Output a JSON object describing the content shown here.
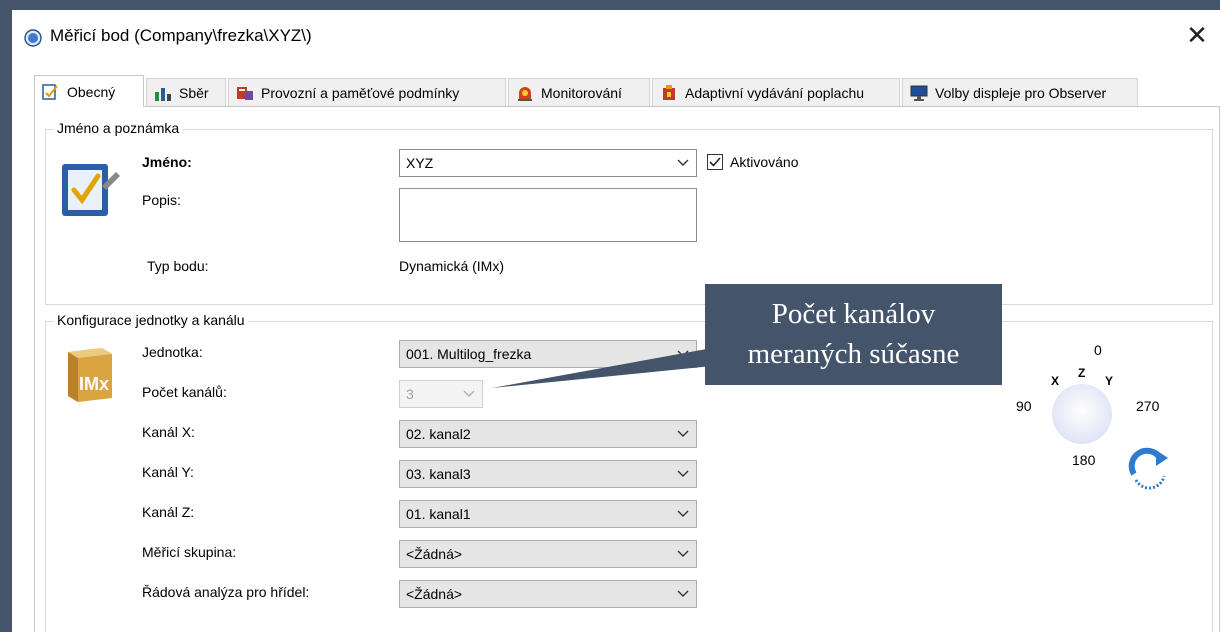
{
  "window": {
    "title": "Měřicí bod (Company\\frezka\\XYZ\\)",
    "close_glyph": "✕"
  },
  "tabs": [
    {
      "label": "Obecný",
      "icon": "general-icon",
      "active": true
    },
    {
      "label": "Sběr",
      "icon": "collection-icon"
    },
    {
      "label": "Provozní a paměťové podmínky",
      "icon": "conditions-icon"
    },
    {
      "label": "Monitorování",
      "icon": "monitoring-icon"
    },
    {
      "label": "Adaptivní vydávání poplachu",
      "icon": "alarm-icon"
    },
    {
      "label": "Volby displeje pro Observer",
      "icon": "monitor-icon"
    }
  ],
  "name_group": {
    "legend": "Jméno a poznámka",
    "name_label": "Jméno:",
    "name_value": "XYZ",
    "enabled_label": "Aktivováno",
    "enabled_checked": true,
    "description_label": "Popis:",
    "description_value": "",
    "point_type_label": "Typ bodu:",
    "point_type_value": "Dynamická (IMx)"
  },
  "config_group": {
    "legend": "Konfigurace jednotky a kanálu",
    "unit_label": "Jednotka:",
    "unit_value": "001. Multilog_frezka",
    "channels_label": "Počet kanálů:",
    "channels_value": "3",
    "channel_x_label": "Kanál X:",
    "channel_x_value": "02. kanal2",
    "channel_y_label": "Kanál Y:",
    "channel_y_value": "03. kanal3",
    "channel_z_label": "Kanál Z:",
    "channel_z_value": "01. kanal1",
    "group_label": "Měřicí skupina:",
    "group_value": "<Žádná>",
    "order_label": "Řádová analýza pro hřídel:",
    "order_value": "<Žádná>",
    "imx_icon_text": "IMx"
  },
  "orientation": {
    "top": "0",
    "left": "90",
    "right": "270",
    "bottom": "180",
    "x": "X",
    "y": "Y",
    "z": "Z"
  },
  "callout": {
    "line1": "Počet kanálov",
    "line2": "meraných súčasne"
  },
  "colors": {
    "frame": "#44546a",
    "callout_bg": "#44546a",
    "combo_bg": "#e5e5e5",
    "rotate_arrow": "#2e7bcf"
  }
}
